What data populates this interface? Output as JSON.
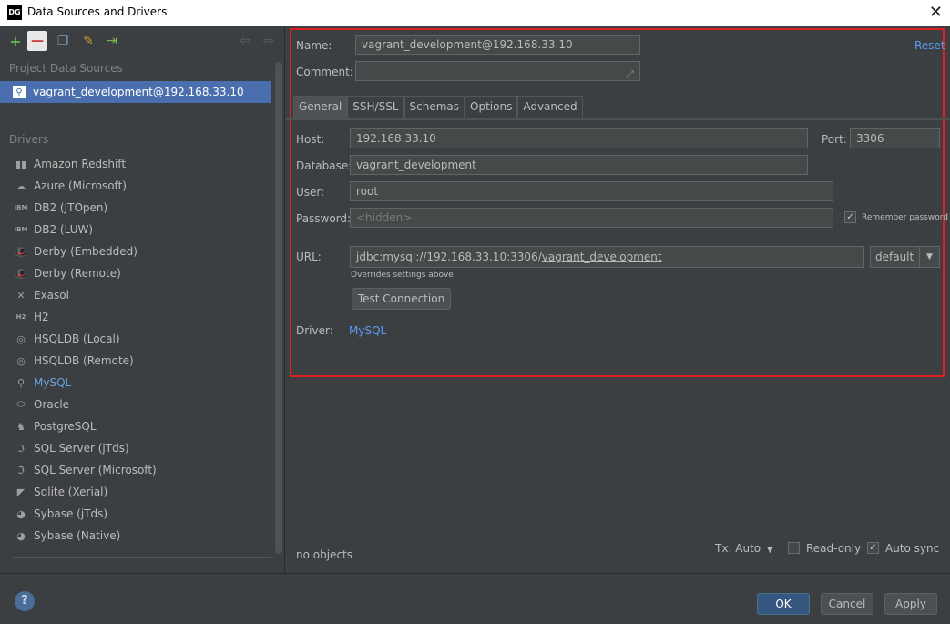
{
  "window": {
    "app_icon": "DG",
    "title": "Data Sources and Drivers"
  },
  "left": {
    "project_header": "Project Data Sources",
    "data_source": "vagrant_development@192.168.33.10",
    "drivers_header": "Drivers",
    "drivers": [
      {
        "label": "Amazon Redshift",
        "icon": "redshift-icon",
        "glyph": "▮▮"
      },
      {
        "label": "Azure (Microsoft)",
        "icon": "azure-icon",
        "glyph": "☁"
      },
      {
        "label": "DB2 (JTOpen)",
        "icon": "db2-icon",
        "glyph": "IBM"
      },
      {
        "label": "DB2 (LUW)",
        "icon": "db2-icon",
        "glyph": "IBM"
      },
      {
        "label": "Derby (Embedded)",
        "icon": "derby-icon",
        "glyph": "🎩"
      },
      {
        "label": "Derby (Remote)",
        "icon": "derby-icon",
        "glyph": "🎩"
      },
      {
        "label": "Exasol",
        "icon": "exasol-icon",
        "glyph": "✕"
      },
      {
        "label": "H2",
        "icon": "h2-icon",
        "glyph": "H2"
      },
      {
        "label": "HSQLDB (Local)",
        "icon": "hsqldb-icon",
        "glyph": "◎"
      },
      {
        "label": "HSQLDB (Remote)",
        "icon": "hsqldb-icon",
        "glyph": "◎"
      },
      {
        "label": "MySQL",
        "icon": "mysql-icon",
        "glyph": "⚲"
      },
      {
        "label": "Oracle",
        "icon": "oracle-icon",
        "glyph": "⬭"
      },
      {
        "label": "PostgreSQL",
        "icon": "postgresql-icon",
        "glyph": "♞"
      },
      {
        "label": "SQL Server (jTds)",
        "icon": "sqlserver-icon",
        "glyph": "ℑ"
      },
      {
        "label": "SQL Server (Microsoft)",
        "icon": "sqlserver-icon",
        "glyph": "ℑ"
      },
      {
        "label": "Sqlite (Xerial)",
        "icon": "sqlite-icon",
        "glyph": "◤"
      },
      {
        "label": "Sybase (jTds)",
        "icon": "sybase-icon",
        "glyph": "◕"
      },
      {
        "label": "Sybase (Native)",
        "icon": "sybase-icon",
        "glyph": "◕"
      }
    ]
  },
  "form": {
    "name_label": "Name:",
    "name_value": "vagrant_development@192.168.33.10",
    "reset": "Reset",
    "comment_label": "Comment:",
    "comment_value": "",
    "tabs": [
      "General",
      "SSH/SSL",
      "Schemas",
      "Options",
      "Advanced"
    ],
    "host_label": "Host:",
    "host_value": "192.168.33.10",
    "port_label": "Port:",
    "port_value": "3306",
    "database_label": "Database:",
    "database_value": "vagrant_development",
    "user_label": "User:",
    "user_value": "root",
    "password_label": "Password:",
    "password_placeholder": "<hidden>",
    "remember_password": "Remember password",
    "url_label": "URL:",
    "url_prefix": "jdbc:mysql://192.168.33.10:3306/",
    "url_db": "vagrant_development",
    "url_mode": "default",
    "overrides_note": "Overrides settings above",
    "test_connection": "Test Connection",
    "driver_label": "Driver:",
    "driver_value": "MySQL"
  },
  "status": {
    "objects": "no objects",
    "tx": "Tx: Auto",
    "read_only": "Read-only",
    "auto_sync": "Auto sync"
  },
  "buttons": {
    "help": "?",
    "ok": "OK",
    "cancel": "Cancel",
    "apply": "Apply"
  }
}
